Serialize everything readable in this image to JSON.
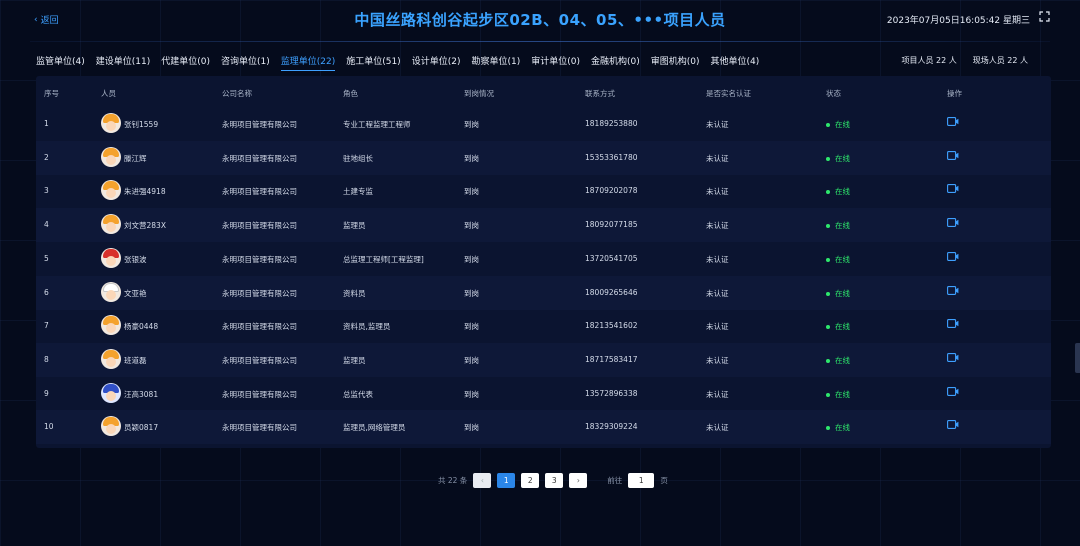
{
  "header": {
    "back_label": "返回",
    "title": "中国丝路科创谷起步区02B、04、05、•••项目人员",
    "datetime": "2023年07月05日16:05:42 星期三"
  },
  "tabs": [
    {
      "label": "监管单位(4)"
    },
    {
      "label": "建设单位(11)"
    },
    {
      "label": "代建单位(0)"
    },
    {
      "label": "咨询单位(1)"
    },
    {
      "label": "监理单位(22)",
      "active": true
    },
    {
      "label": "施工单位(51)"
    },
    {
      "label": "设计单位(2)"
    },
    {
      "label": "勘察单位(1)"
    },
    {
      "label": "审计单位(0)"
    },
    {
      "label": "金融机构(0)"
    },
    {
      "label": "审图机构(0)"
    },
    {
      "label": "其他单位(4)"
    }
  ],
  "counts": {
    "project_staff": "项目人员 22 人",
    "onsite_staff": "现场人员 22 人"
  },
  "table": {
    "headers": {
      "index": "序号",
      "person": "人员",
      "company": "公司名称",
      "role": "角色",
      "arrival": "到岗情况",
      "contact": "联系方式",
      "verified": "是否实名认证",
      "status": "状态",
      "action": "操作"
    },
    "rows": [
      {
        "index": "1",
        "name": "张钊1559",
        "company": "永明项目管理有限公司",
        "role": "专业工程监理工程师",
        "arrival": "到岗",
        "phone": "18189253880",
        "verified": "未认证",
        "status": "在线",
        "avatar": "orange"
      },
      {
        "index": "2",
        "name": "滕江辉",
        "company": "永明项目管理有限公司",
        "role": "驻地组长",
        "arrival": "到岗",
        "phone": "15353361780",
        "verified": "未认证",
        "status": "在线",
        "avatar": "orange"
      },
      {
        "index": "3",
        "name": "朱进强4918",
        "company": "永明项目管理有限公司",
        "role": "土建专监",
        "arrival": "到岗",
        "phone": "18709202078",
        "verified": "未认证",
        "status": "在线",
        "avatar": "orange"
      },
      {
        "index": "4",
        "name": "刘文营283X",
        "company": "永明项目管理有限公司",
        "role": "监理员",
        "arrival": "到岗",
        "phone": "18092077185",
        "verified": "未认证",
        "status": "在线",
        "avatar": "orange"
      },
      {
        "index": "5",
        "name": "张银波",
        "company": "永明项目管理有限公司",
        "role": "总监理工程师[工程监理]",
        "arrival": "到岗",
        "phone": "13720541705",
        "verified": "未认证",
        "status": "在线",
        "avatar": "red"
      },
      {
        "index": "6",
        "name": "文亚艳",
        "company": "永明项目管理有限公司",
        "role": "资料员",
        "arrival": "到岗",
        "phone": "18009265646",
        "verified": "未认证",
        "status": "在线",
        "avatar": "plain"
      },
      {
        "index": "7",
        "name": "杨豪0448",
        "company": "永明项目管理有限公司",
        "role": "资料员,监理员",
        "arrival": "到岗",
        "phone": "18213541602",
        "verified": "未认证",
        "status": "在线",
        "avatar": "orange"
      },
      {
        "index": "8",
        "name": "班道磊",
        "company": "永明项目管理有限公司",
        "role": "监理员",
        "arrival": "到岗",
        "phone": "18717583417",
        "verified": "未认证",
        "status": "在线",
        "avatar": "orange"
      },
      {
        "index": "9",
        "name": "汪高3081",
        "company": "永明项目管理有限公司",
        "role": "总监代表",
        "arrival": "到岗",
        "phone": "13572896338",
        "verified": "未认证",
        "status": "在线",
        "avatar": "blue"
      },
      {
        "index": "10",
        "name": "员颖0817",
        "company": "永明项目管理有限公司",
        "role": "监理员,网络管理员",
        "arrival": "到岗",
        "phone": "18329309224",
        "verified": "未认证",
        "status": "在线",
        "avatar": "orange"
      }
    ]
  },
  "pagination": {
    "total_label": "共 22 条",
    "pages": [
      "1",
      "2",
      "3"
    ],
    "current": "1",
    "goto_label": "前往",
    "goto_value": "1",
    "page_suffix": "页"
  },
  "colors": {
    "accent": "#3ea0ff",
    "online": "#2ee86c",
    "background": "#050b1c",
    "panel": "#0b1430"
  }
}
